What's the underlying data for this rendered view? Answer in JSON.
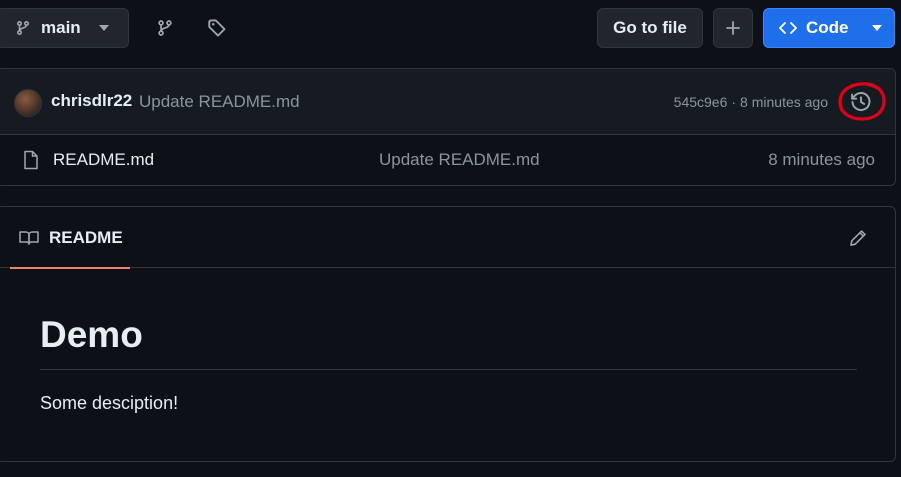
{
  "topbar": {
    "branch_label": "main",
    "goto_file_label": "Go to file",
    "code_label": "Code"
  },
  "commit": {
    "author": "chrisdlr22",
    "message": "Update README.md",
    "sha": "545c9e6",
    "separator": "·",
    "time": "8 minutes ago"
  },
  "files": [
    {
      "name": "README.md",
      "message": "Update README.md",
      "time": "8 minutes ago"
    }
  ],
  "readme": {
    "tab_label": "README",
    "heading": "Demo",
    "paragraph": "Some desciption!"
  },
  "icons": {
    "branch": "git-branch-icon",
    "branches": "branches-icon",
    "tags": "tag-icon",
    "plus": "plus-icon",
    "code": "code-icon",
    "history": "history-icon",
    "file": "file-icon",
    "book": "book-icon",
    "edit": "pencil-icon"
  },
  "colors": {
    "background": "#0d1117",
    "header_bg": "#161b22",
    "border": "#30363d",
    "primary_button": "#1f6feb",
    "muted_text": "#8b949e",
    "active_tab_underline": "#f78166",
    "annotation_circle": "#e0001b"
  }
}
